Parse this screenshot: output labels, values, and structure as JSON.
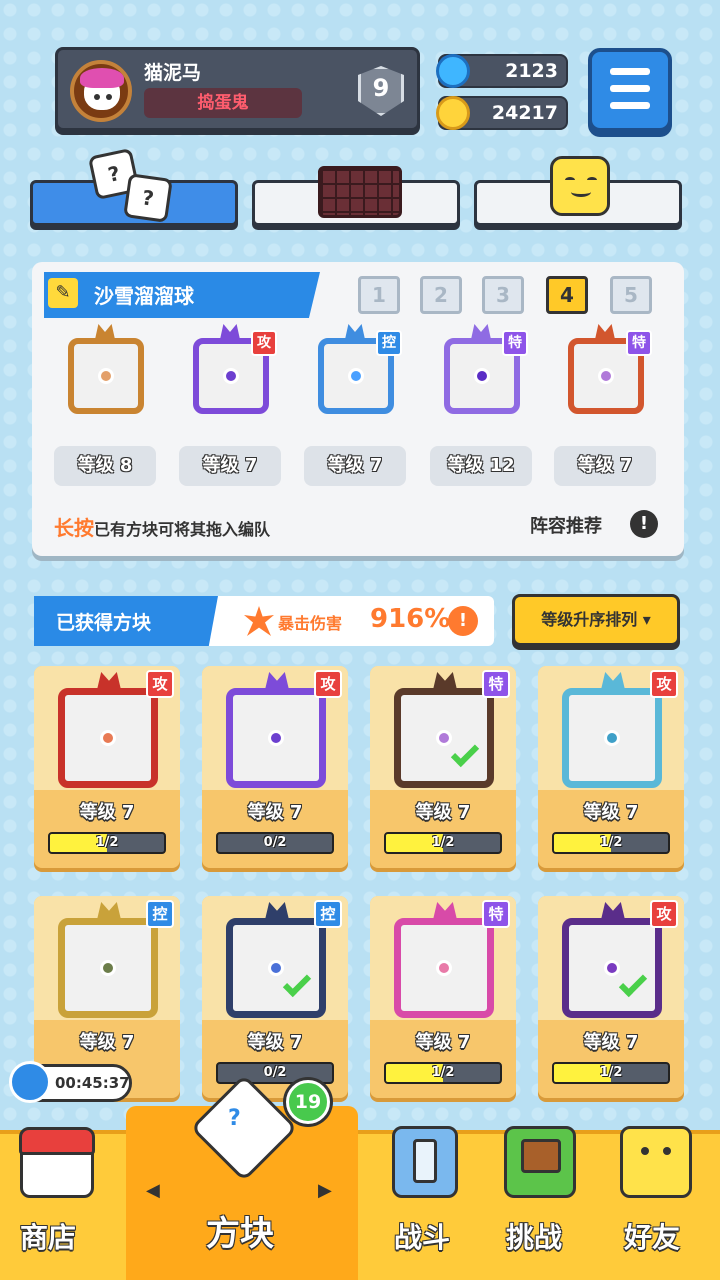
{
  "profile": {
    "name": "猫泥马",
    "title": "捣蛋鬼",
    "rank": "9"
  },
  "currency": {
    "gems": "2123",
    "coins": "24217"
  },
  "top_tabs": [
    {
      "icon": "dice-icon"
    },
    {
      "icon": "grid-icon"
    },
    {
      "icon": "smile-icon"
    }
  ],
  "deck": {
    "name": "沙雪溜溜球",
    "slots": [
      "1",
      "2",
      "3",
      "4",
      "5"
    ],
    "active_slot": "4",
    "cards": [
      {
        "level": "等级 8",
        "type": "",
        "color": "#c98431",
        "dot": "#e3a06a"
      },
      {
        "level": "等级 7",
        "type": "攻",
        "color": "#7d4bd9",
        "dot": "#6c3fcf"
      },
      {
        "level": "等级 7",
        "type": "控",
        "color": "#3f8de0",
        "dot": "#4aa0ff"
      },
      {
        "level": "等级 12",
        "type": "特",
        "color": "#8f6be3",
        "dot": "#5a2dc5"
      },
      {
        "level": "等级 7",
        "type": "特",
        "color": "#d2562e",
        "dot": "#b07ad9"
      }
    ],
    "hint_emph": "长按",
    "hint_text": "已有方块可将其拖入编队",
    "recommend": "阵容推荐"
  },
  "owned": {
    "title": "已获得方块",
    "crit_label": "暴击伤害",
    "crit_value": "916%",
    "sort_label": "等级升序排列",
    "cards": [
      {
        "level": "等级 7",
        "progress": "1/2",
        "pct": 0.5,
        "type": "攻",
        "color": "#c8322a",
        "dot": "#e87a54",
        "check": false
      },
      {
        "level": "等级 7",
        "progress": "0/2",
        "pct": 0,
        "type": "攻",
        "color": "#7d4bd9",
        "dot": "#6c3fcf",
        "check": false
      },
      {
        "level": "等级 7",
        "progress": "1/2",
        "pct": 0.5,
        "type": "特",
        "color": "#5a3a2a",
        "dot": "#b07ad9",
        "check": true
      },
      {
        "level": "等级 7",
        "progress": "1/2",
        "pct": 0.5,
        "type": "攻",
        "color": "#5ab8d8",
        "dot": "#3fa0c8",
        "check": false
      },
      {
        "level": "等级 7",
        "progress": "",
        "pct": 0,
        "type": "控",
        "color": "#c9a23a",
        "dot": "#6c7d4a",
        "check": false
      },
      {
        "level": "等级 7",
        "progress": "0/2",
        "pct": 0,
        "type": "控",
        "color": "#2f3f6a",
        "dot": "#4a70d8",
        "check": true
      },
      {
        "level": "等级 7",
        "progress": "1/2",
        "pct": 0.5,
        "type": "特",
        "color": "#d84aa8",
        "dot": "#e87aa8",
        "check": false
      },
      {
        "level": "等级 7",
        "progress": "1/2",
        "pct": 0.5,
        "type": "攻",
        "color": "#5a2d8a",
        "dot": "#7a3bc0",
        "check": true
      }
    ]
  },
  "timer": "00:45:37",
  "nav": {
    "shop": "商店",
    "blocks": "方块",
    "blocks_badge": "19",
    "battle": "战斗",
    "challenge": "挑战",
    "friends": "好友",
    "active": "blocks"
  }
}
